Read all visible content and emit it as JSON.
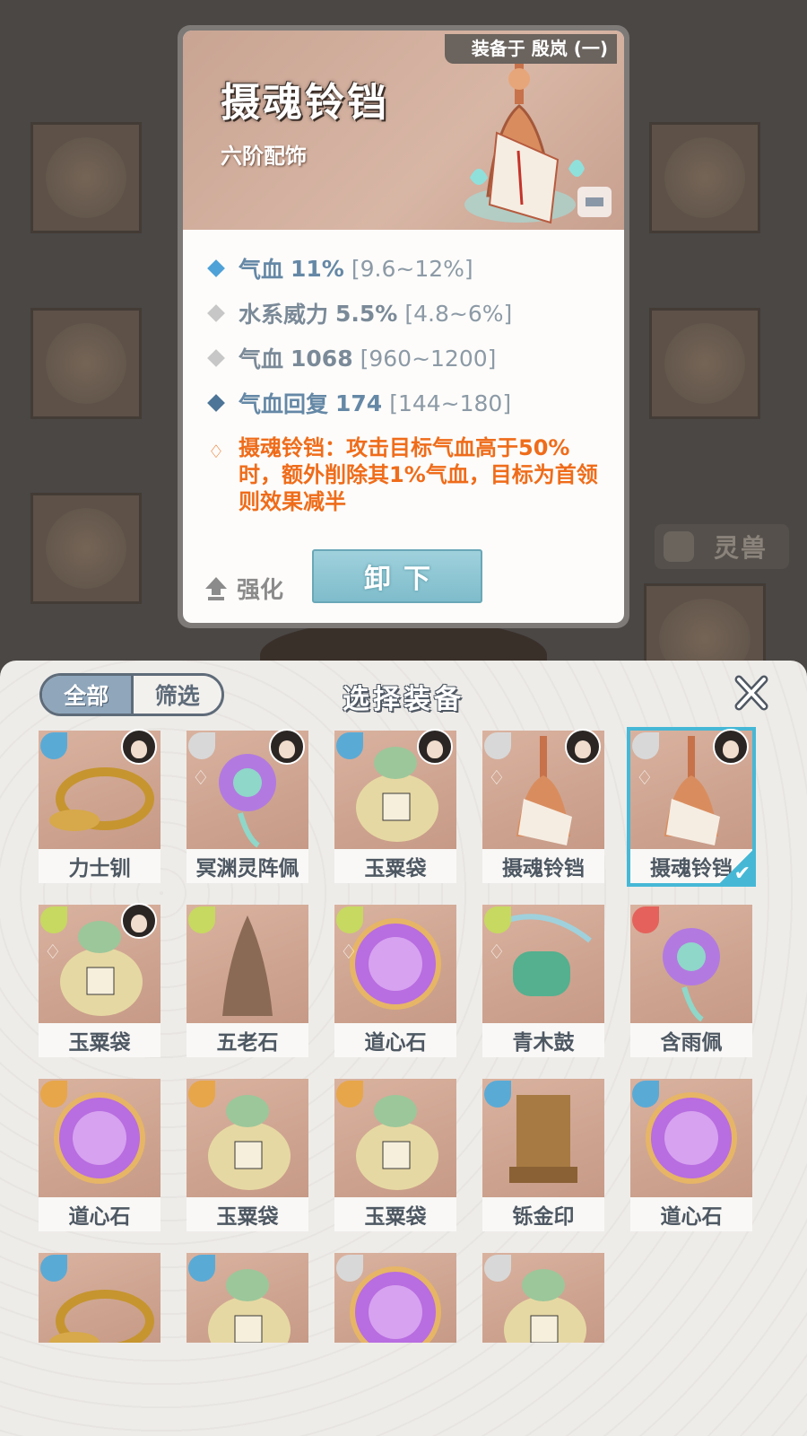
{
  "detail": {
    "equipped_on": "装备于 殷岚 (一)",
    "title": "摄魂铃铛",
    "subtitle": "六阶配饰",
    "stats": [
      {
        "name": "气血",
        "value": "11%",
        "range": "[9.6~12%]"
      },
      {
        "name": "水系威力",
        "value": "5.5%",
        "range": "[4.8~6%]"
      },
      {
        "name": "气血",
        "value": "1068",
        "range": "[960~1200]"
      },
      {
        "name": "气血回复",
        "value": "174",
        "range": "[144~180]"
      }
    ],
    "special_effect": "摄魂铃铛：攻击目标气血高于50%时，额外削除其1%气血，目标为首领则效果减半",
    "enhance_label": "强化",
    "unequip_label": "卸下"
  },
  "background": {
    "beast_tab": "灵兽"
  },
  "panel": {
    "filter_all": "全部",
    "filter_screen": "筛选",
    "title": "选择装备",
    "close_icon": "close-icon",
    "items": [
      {
        "name": "力士钏",
        "element": "water",
        "avatar": true,
        "lock": false,
        "enchant": false,
        "selected": false
      },
      {
        "name": "冥渊灵阵佩",
        "element": "metal",
        "avatar": true,
        "lock": false,
        "enchant": true,
        "selected": false
      },
      {
        "name": "玉粟袋",
        "element": "water",
        "avatar": true,
        "lock": true,
        "enchant": false,
        "selected": false
      },
      {
        "name": "摄魂铃铛",
        "element": "metal",
        "avatar": true,
        "lock": false,
        "enchant": true,
        "selected": false
      },
      {
        "name": "摄魂铃铛",
        "element": "metal",
        "avatar": true,
        "lock": false,
        "enchant": true,
        "selected": true
      },
      {
        "name": "玉粟袋",
        "element": "wood",
        "avatar": true,
        "lock": false,
        "enchant": true,
        "selected": false
      },
      {
        "name": "五老石",
        "element": "wood",
        "avatar": false,
        "lock": true,
        "enchant": false,
        "selected": false
      },
      {
        "name": "道心石",
        "element": "wood",
        "avatar": false,
        "lock": true,
        "enchant": true,
        "selected": false
      },
      {
        "name": "青木鼓",
        "element": "wood",
        "avatar": false,
        "lock": true,
        "enchant": true,
        "selected": false
      },
      {
        "name": "含雨佩",
        "element": "fire",
        "avatar": false,
        "lock": false,
        "enchant": false,
        "selected": false
      },
      {
        "name": "道心石",
        "element": "earth",
        "avatar": false,
        "lock": true,
        "enchant": false,
        "selected": false
      },
      {
        "name": "玉粟袋",
        "element": "earth",
        "avatar": false,
        "lock": true,
        "enchant": false,
        "selected": false
      },
      {
        "name": "玉粟袋",
        "element": "earth",
        "avatar": false,
        "lock": true,
        "enchant": false,
        "selected": false
      },
      {
        "name": "铄金印",
        "element": "water",
        "avatar": false,
        "lock": true,
        "enchant": false,
        "selected": false
      },
      {
        "name": "道心石",
        "element": "water",
        "avatar": false,
        "lock": true,
        "enchant": false,
        "selected": false
      },
      {
        "name": "",
        "element": "water",
        "avatar": false,
        "lock": false,
        "enchant": false,
        "selected": false
      },
      {
        "name": "",
        "element": "water",
        "avatar": false,
        "lock": false,
        "enchant": false,
        "selected": false
      },
      {
        "name": "",
        "element": "metal",
        "avatar": false,
        "lock": false,
        "enchant": false,
        "selected": false
      },
      {
        "name": "",
        "element": "metal",
        "avatar": false,
        "lock": false,
        "enchant": false,
        "selected": false
      }
    ]
  },
  "colors": {
    "stat_blue": "#6588a6",
    "special_orange": "#ef6c1a",
    "select_cyan": "#46b8d6",
    "element_water": "#5aaad6",
    "element_metal": "#d8d8d8",
    "element_wood": "#c7d960",
    "element_fire": "#e5625c",
    "element_earth": "#e7a64a"
  }
}
